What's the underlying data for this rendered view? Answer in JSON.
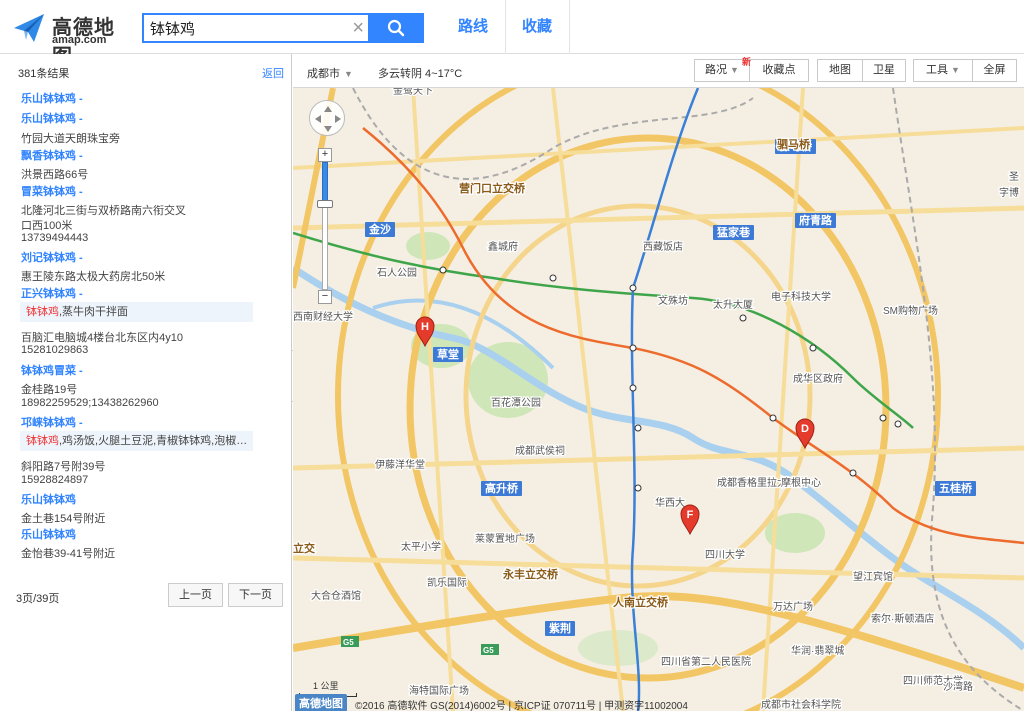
{
  "header": {
    "logo_cn": "高德地图",
    "logo_en": "amap.com",
    "search_value": "钵钵鸡",
    "nav_route": "路线",
    "nav_favorites": "收藏"
  },
  "sidebar": {
    "result_count": "381条结果",
    "back_label": "返回",
    "rows": [
      {
        "kind": "title",
        "text": "乐山钵钵鸡 -"
      },
      {
        "kind": "title",
        "text": "乐山钵钵鸡 -"
      },
      {
        "kind": "text",
        "text": "竹园大道天朗珠宝旁"
      },
      {
        "kind": "title",
        "text": "飘香钵钵鸡 -"
      },
      {
        "kind": "text",
        "text": "洪景西路66号"
      },
      {
        "kind": "title",
        "text": "冒菜钵钵鸡 -"
      },
      {
        "kind": "text",
        "text": "北隆河北三街与双桥路南六衔交叉"
      },
      {
        "kind": "text",
        "text": "口西100米"
      },
      {
        "kind": "text",
        "text": "13739494443"
      },
      {
        "kind": "title",
        "text": "刘记钵钵鸡 -"
      },
      {
        "kind": "text",
        "text": "惠王陵东路太极大药房北50米"
      },
      {
        "kind": "title",
        "text": "正兴钵钵鸡 -"
      },
      {
        "kind": "hi",
        "kw": "钵钵鸡",
        "rest": ",蒸牛肉干拌面"
      },
      {
        "kind": "text",
        "text": "百脑汇电脑城4楼台北东区内4y10"
      },
      {
        "kind": "text",
        "text": "15281029863"
      },
      {
        "kind": "title",
        "text": "钵钵鸡冒菜 -"
      },
      {
        "kind": "text",
        "text": "金桂路19号"
      },
      {
        "kind": "text",
        "text": "18982259529;13438262960"
      },
      {
        "kind": "title",
        "text": "邛崃钵钵鸡 -"
      },
      {
        "kind": "hi",
        "kw": "钵钵鸡",
        "rest": ",鸡汤饭,火腿土豆泥,青椒钵钵鸡,泡椒土..."
      },
      {
        "kind": "text",
        "text": "斜阳路7号附39号"
      },
      {
        "kind": "text",
        "text": "15928824897"
      },
      {
        "kind": "title",
        "text": "乐山钵钵鸡"
      },
      {
        "kind": "text",
        "text": "金土巷154号附近"
      },
      {
        "kind": "title",
        "text": "乐山钵钵鸡"
      },
      {
        "kind": "text",
        "text": "金怡巷39-41号附近"
      }
    ],
    "page_info": "3页/39页",
    "prev_label": "上一页",
    "next_label": "下一页"
  },
  "map_toolbar": {
    "city": "成都市",
    "weather": "多云转阴 4~17°C",
    "traffic": "路况",
    "new_badge": "新",
    "favorites_point": "收藏点",
    "map": "地图",
    "satellite": "卫星",
    "tools": "工具",
    "fullscreen": "全屏"
  },
  "map": {
    "scale_label": "1 公里",
    "bottom_logo": "高德地图",
    "copyright": "©2016 高德软件 GS(2014)6002号 | 京ICP证 070711号 | 甲测资字11002004",
    "blue_labels": [
      "金沙",
      "草堂",
      "高升桥",
      "紫荆",
      "骡马桥",
      "府青路",
      "猛家巷",
      "五桂桥"
    ],
    "road_labels": [
      "营门口立交桥",
      "永丰立交桥",
      "人南立交桥",
      "蜀天立交",
      "立交",
      "驷马桥"
    ],
    "place_labels": [
      "金鹭天下",
      "鑫城府",
      "西藏饭店",
      "文殊坊",
      "太升大厦",
      "电子科技大学",
      "SM购物广场",
      "成华区政府",
      "石人公园",
      "西南财经大学",
      "百花潭公园",
      "成都武侯祠",
      "伊藤洋华堂",
      "成都香格里拉大酒店",
      "摩根中心",
      "华西大",
      "四川大学",
      "莱蒙置地广场",
      "太平小学",
      "凯乐国际",
      "大合仓酒馆",
      "望江宾馆",
      "索尔·斯顿酒店",
      "万达广场",
      "华润·翡翠城",
      "四川省第二人民医院",
      "海特国际广场",
      "成都市社会科学院",
      "四川师范大学",
      "凯丹广场",
      "沙湾路",
      "圣",
      "字博"
    ],
    "road_shields": [
      "G5",
      "G5"
    ],
    "markers": [
      "H",
      "D",
      "F"
    ]
  }
}
